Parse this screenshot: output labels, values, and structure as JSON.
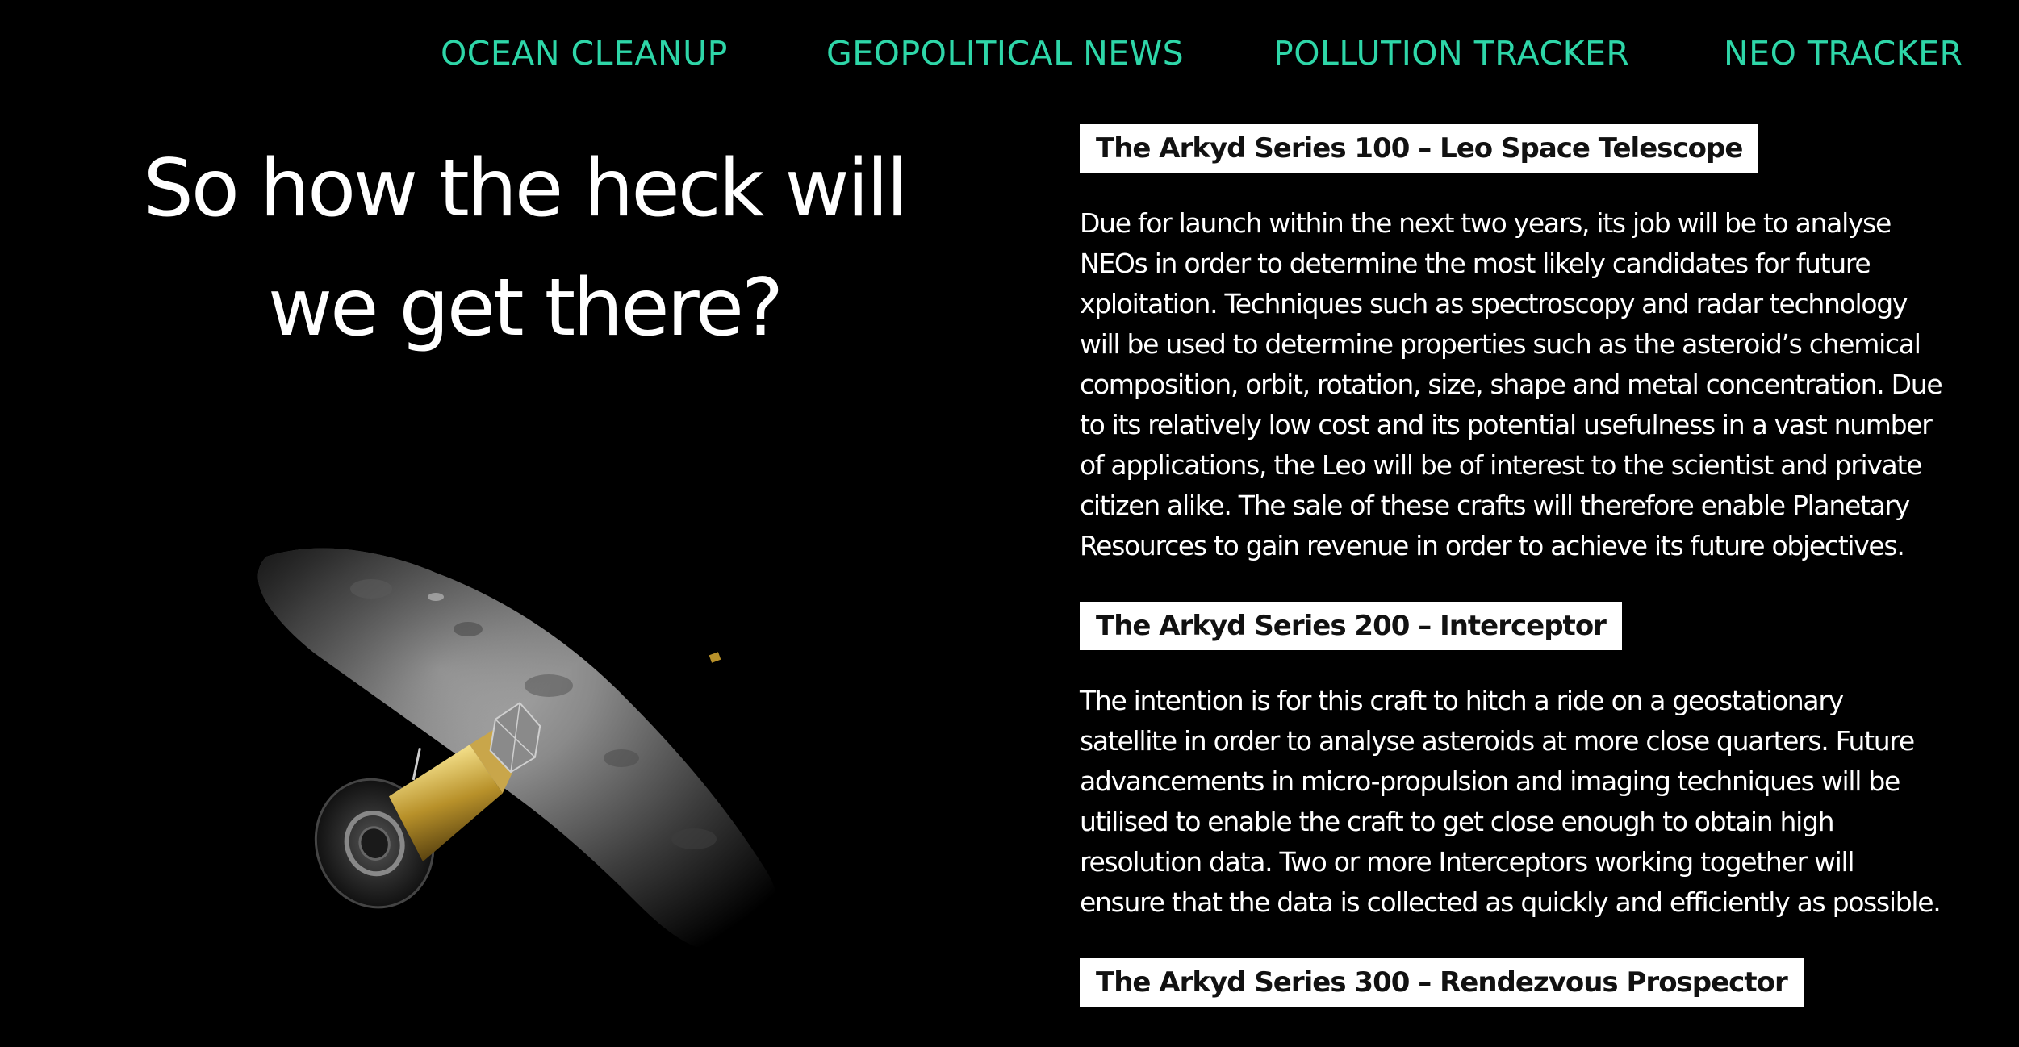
{
  "nav": {
    "items": [
      {
        "label": "OCEAN CLEANUP"
      },
      {
        "label": "GEOPOLITICAL NEWS"
      },
      {
        "label": "POLLUTION TRACKER"
      },
      {
        "label": "NEO TRACKER"
      }
    ]
  },
  "hero": {
    "heading": "So how the heck will we get there?",
    "image_icon": "asteroid-and-spacecraft-illustration"
  },
  "sections": [
    {
      "title": "The Arkyd Series 100 – Leo Space Telescope",
      "body": "Due for launch within the next two years, its job will be to analyse NEOs in order to determine the most likely candidates for future xploitation. Techniques such as spectroscopy and radar technology will be used to determine properties such as the asteroid’s chemical composition, orbit, rotation, size, shape and metal concentration. Due to its relatively low cost and its potential usefulness in a vast number of applications, the Leo will be of interest to the scientist and private citizen alike. The sale of these crafts will therefore enable Planetary Resources to gain revenue in order to achieve its future objectives."
    },
    {
      "title": "The Arkyd Series 200 – Interceptor",
      "body": "The intention is for this craft to hitch a ride on a geostationary satellite in order to analyse asteroids at more close quarters. Future advancements in micro-propulsion and imaging techniques will be utilised to enable the craft to get close enough to obtain high resolution data. Two or more Interceptors working together will ensure that the data is collected as quickly and efficiently as possible."
    },
    {
      "title": "The Arkyd Series 300 – Rendezvous Prospector"
    }
  ],
  "colors": {
    "background": "#000000",
    "nav_accent": "#2ed6a8",
    "text": "#ffffff",
    "title_bg": "#ffffff",
    "title_text": "#111111"
  }
}
